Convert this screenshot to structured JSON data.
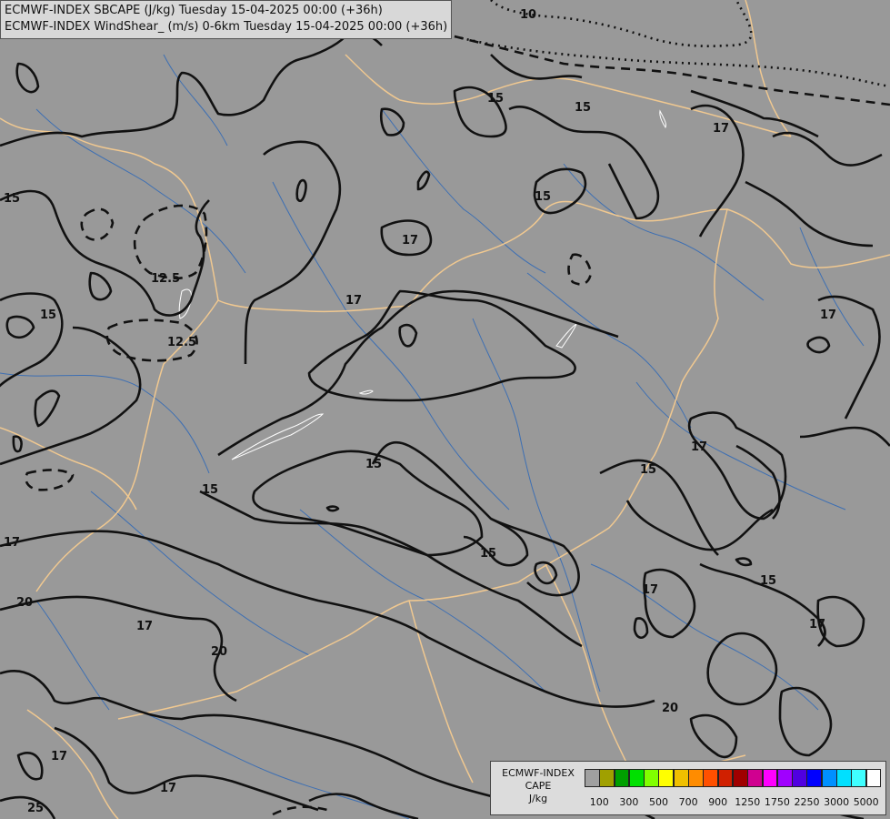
{
  "title": {
    "line1": "ECMWF-INDEX SBCAPE (J/kg) Tuesday 15-04-2025 00:00 (+36h)",
    "line2": "ECMWF-INDEX WindShear_ (m/s) 0-6km Tuesday 15-04-2025 00:00 (+36h)"
  },
  "map": {
    "background_color": "#999999",
    "border_color": "#f0c890",
    "river_color": "#3d6fb3",
    "contour_color": "#111111",
    "lake_outline_color": "#ffffff"
  },
  "contour_labels": [
    "10",
    "15",
    "15",
    "15",
    "15",
    "15",
    "15",
    "15",
    "15",
    "17",
    "17",
    "17",
    "17",
    "17",
    "17",
    "17",
    "17",
    "17",
    "17",
    "20",
    "20",
    "20",
    "25",
    "12.5",
    "12.5",
    "15",
    "15",
    "17"
  ],
  "legend": {
    "label_line1": "ECMWF-INDEX",
    "label_line2": "CAPE",
    "label_line3": "J/kg",
    "colors": [
      "#a0a0a0",
      "#a0a000",
      "#00a000",
      "#00e000",
      "#80ff00",
      "#ffff00",
      "#f0c000",
      "#ff8c00",
      "#ff5000",
      "#d02000",
      "#a00000",
      "#d00090",
      "#ff00ff",
      "#a000ff",
      "#5000e0",
      "#0000ff",
      "#0090ff",
      "#00e0ff",
      "#40ffff",
      "#ffffff"
    ],
    "ticks": [
      "100",
      "300",
      "500",
      "700",
      "900",
      "1250",
      "1750",
      "2250",
      "3000",
      "5000"
    ]
  }
}
